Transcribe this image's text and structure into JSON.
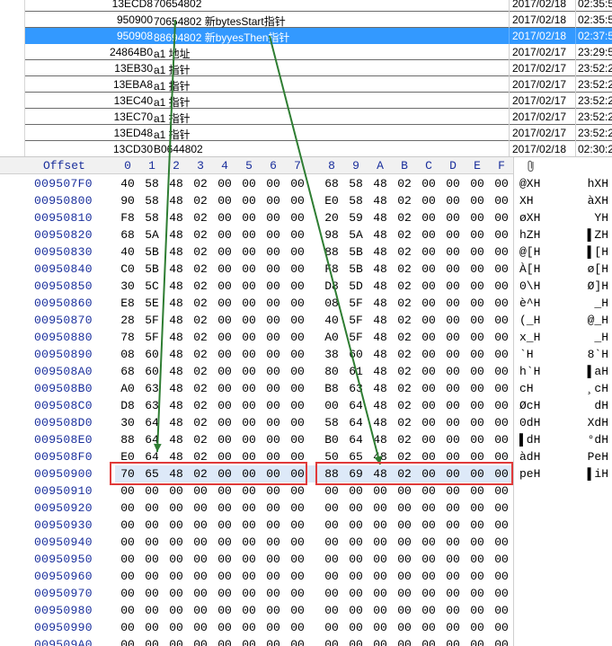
{
  "list": {
    "rows": [
      {
        "addr": "13ECD8",
        "desc": "70654802",
        "date": "2017/02/18",
        "time": "02:35:5",
        "selected": false
      },
      {
        "addr": "950900",
        "desc": "70654802  新bytesStart指针",
        "date": "2017/02/18",
        "time": "02:35:5",
        "selected": false
      },
      {
        "addr": "950908",
        "desc": "88694802  新byyesThen指针",
        "date": "2017/02/18",
        "time": "02:37:5",
        "selected": true
      },
      {
        "addr": "24864B0",
        "desc": "a1 地址",
        "date": "2017/02/17",
        "time": "23:29:5",
        "selected": false
      },
      {
        "addr": "13EB30",
        "desc": "a1 指针",
        "date": "2017/02/17",
        "time": "23:52:2",
        "selected": false
      },
      {
        "addr": "13EBA8",
        "desc": "a1 指针",
        "date": "2017/02/17",
        "time": "23:52:2",
        "selected": false
      },
      {
        "addr": "13EC40",
        "desc": "a1 指针",
        "date": "2017/02/17",
        "time": "23:52:2",
        "selected": false
      },
      {
        "addr": "13EC70",
        "desc": "a1 指针",
        "date": "2017/02/17",
        "time": "23:52:2",
        "selected": false
      },
      {
        "addr": "13ED48",
        "desc": "a1 指针",
        "date": "2017/02/17",
        "time": "23:52:2",
        "selected": false
      },
      {
        "addr": "13CD30",
        "desc": "B0644802",
        "date": "2017/02/18",
        "time": "02:30:2",
        "selected": false
      }
    ]
  },
  "hex": {
    "header_offset": "Offset",
    "column_headers": [
      "0",
      "1",
      "2",
      "3",
      "4",
      "5",
      "6",
      "7",
      "8",
      "9",
      "A",
      "B",
      "C",
      "D",
      "E",
      "F"
    ],
    "clip_icon": "paperclip-icon",
    "rows": [
      {
        "off": "009507F0",
        "bytes": [
          "40",
          "58",
          "48",
          "02",
          "00",
          "00",
          "00",
          "00",
          "68",
          "58",
          "48",
          "02",
          "00",
          "00",
          "00",
          "00"
        ],
        "t1": "@XH",
        "t2": "hXH"
      },
      {
        "off": "00950800",
        "bytes": [
          "90",
          "58",
          "48",
          "02",
          "00",
          "00",
          "00",
          "00",
          "E0",
          "58",
          "48",
          "02",
          "00",
          "00",
          "00",
          "00"
        ],
        "t1": " XH",
        "t2": "àXH"
      },
      {
        "off": "00950810",
        "bytes": [
          "F8",
          "58",
          "48",
          "02",
          "00",
          "00",
          "00",
          "00",
          "20",
          "59",
          "48",
          "02",
          "00",
          "00",
          "00",
          "00"
        ],
        "t1": "øXH",
        "t2": "YH"
      },
      {
        "off": "00950820",
        "bytes": [
          "68",
          "5A",
          "48",
          "02",
          "00",
          "00",
          "00",
          "00",
          "98",
          "5A",
          "48",
          "02",
          "00",
          "00",
          "00",
          "00"
        ],
        "t1": "hZH",
        "t2": "▌ZH"
      },
      {
        "off": "00950830",
        "bytes": [
          "40",
          "5B",
          "48",
          "02",
          "00",
          "00",
          "00",
          "00",
          "88",
          "5B",
          "48",
          "02",
          "00",
          "00",
          "00",
          "00"
        ],
        "t1": "@[H",
        "t2": "▌[H"
      },
      {
        "off": "00950840",
        "bytes": [
          "C0",
          "5B",
          "48",
          "02",
          "00",
          "00",
          "00",
          "00",
          "F8",
          "5B",
          "48",
          "02",
          "00",
          "00",
          "00",
          "00"
        ],
        "t1": "À[H",
        "t2": "ø[H"
      },
      {
        "off": "00950850",
        "bytes": [
          "30",
          "5C",
          "48",
          "02",
          "00",
          "00",
          "00",
          "00",
          "D8",
          "5D",
          "48",
          "02",
          "00",
          "00",
          "00",
          "00"
        ],
        "t1": "0\\H",
        "t2": "Ø]H"
      },
      {
        "off": "00950860",
        "bytes": [
          "E8",
          "5E",
          "48",
          "02",
          "00",
          "00",
          "00",
          "00",
          "08",
          "5F",
          "48",
          "02",
          "00",
          "00",
          "00",
          "00"
        ],
        "t1": "è^H",
        "t2": "_H"
      },
      {
        "off": "00950870",
        "bytes": [
          "28",
          "5F",
          "48",
          "02",
          "00",
          "00",
          "00",
          "00",
          "40",
          "5F",
          "48",
          "02",
          "00",
          "00",
          "00",
          "00"
        ],
        "t1": "(_H",
        "t2": "@_H"
      },
      {
        "off": "00950880",
        "bytes": [
          "78",
          "5F",
          "48",
          "02",
          "00",
          "00",
          "00",
          "00",
          "A0",
          "5F",
          "48",
          "02",
          "00",
          "00",
          "00",
          "00"
        ],
        "t1": "x_H",
        "t2": "_H"
      },
      {
        "off": "00950890",
        "bytes": [
          "08",
          "60",
          "48",
          "02",
          "00",
          "00",
          "00",
          "00",
          "38",
          "60",
          "48",
          "02",
          "00",
          "00",
          "00",
          "00"
        ],
        "t1": "`H",
        "t2": "8`H"
      },
      {
        "off": "009508A0",
        "bytes": [
          "68",
          "60",
          "48",
          "02",
          "00",
          "00",
          "00",
          "00",
          "80",
          "61",
          "48",
          "02",
          "00",
          "00",
          "00",
          "00"
        ],
        "t1": "h`H",
        "t2": "▌aH"
      },
      {
        "off": "009508B0",
        "bytes": [
          "A0",
          "63",
          "48",
          "02",
          "00",
          "00",
          "00",
          "00",
          "B8",
          "63",
          "48",
          "02",
          "00",
          "00",
          "00",
          "00"
        ],
        "t1": "cH",
        "t2": "¸cH"
      },
      {
        "off": "009508C0",
        "bytes": [
          "D8",
          "63",
          "48",
          "02",
          "00",
          "00",
          "00",
          "00",
          "00",
          "64",
          "48",
          "02",
          "00",
          "00",
          "00",
          "00"
        ],
        "t1": "ØcH",
        "t2": "dH"
      },
      {
        "off": "009508D0",
        "bytes": [
          "30",
          "64",
          "48",
          "02",
          "00",
          "00",
          "00",
          "00",
          "58",
          "64",
          "48",
          "02",
          "00",
          "00",
          "00",
          "00"
        ],
        "t1": "0dH",
        "t2": "XdH"
      },
      {
        "off": "009508E0",
        "bytes": [
          "88",
          "64",
          "48",
          "02",
          "00",
          "00",
          "00",
          "00",
          "B0",
          "64",
          "48",
          "02",
          "00",
          "00",
          "00",
          "00"
        ],
        "t1": "▌dH",
        "t2": "°dH"
      },
      {
        "off": "009508F0",
        "bytes": [
          "E0",
          "64",
          "48",
          "02",
          "00",
          "00",
          "00",
          "00",
          "50",
          "65",
          "48",
          "02",
          "00",
          "00",
          "00",
          "00"
        ],
        "t1": "àdH",
        "t2": "PeH"
      },
      {
        "off": "00950900",
        "bytes": [
          "70",
          "65",
          "48",
          "02",
          "00",
          "00",
          "00",
          "00",
          "88",
          "69",
          "48",
          "02",
          "00",
          "00",
          "00",
          "00"
        ],
        "t1": "peH",
        "t2": "▌iH"
      },
      {
        "off": "00950910",
        "bytes": [
          "00",
          "00",
          "00",
          "00",
          "00",
          "00",
          "00",
          "00",
          "00",
          "00",
          "00",
          "00",
          "00",
          "00",
          "00",
          "00"
        ],
        "t1": "",
        "t2": ""
      },
      {
        "off": "00950920",
        "bytes": [
          "00",
          "00",
          "00",
          "00",
          "00",
          "00",
          "00",
          "00",
          "00",
          "00",
          "00",
          "00",
          "00",
          "00",
          "00",
          "00"
        ],
        "t1": "",
        "t2": ""
      },
      {
        "off": "00950930",
        "bytes": [
          "00",
          "00",
          "00",
          "00",
          "00",
          "00",
          "00",
          "00",
          "00",
          "00",
          "00",
          "00",
          "00",
          "00",
          "00",
          "00"
        ],
        "t1": "",
        "t2": ""
      },
      {
        "off": "00950940",
        "bytes": [
          "00",
          "00",
          "00",
          "00",
          "00",
          "00",
          "00",
          "00",
          "00",
          "00",
          "00",
          "00",
          "00",
          "00",
          "00",
          "00"
        ],
        "t1": "",
        "t2": ""
      },
      {
        "off": "00950950",
        "bytes": [
          "00",
          "00",
          "00",
          "00",
          "00",
          "00",
          "00",
          "00",
          "00",
          "00",
          "00",
          "00",
          "00",
          "00",
          "00",
          "00"
        ],
        "t1": "",
        "t2": ""
      },
      {
        "off": "00950960",
        "bytes": [
          "00",
          "00",
          "00",
          "00",
          "00",
          "00",
          "00",
          "00",
          "00",
          "00",
          "00",
          "00",
          "00",
          "00",
          "00",
          "00"
        ],
        "t1": "",
        "t2": ""
      },
      {
        "off": "00950970",
        "bytes": [
          "00",
          "00",
          "00",
          "00",
          "00",
          "00",
          "00",
          "00",
          "00",
          "00",
          "00",
          "00",
          "00",
          "00",
          "00",
          "00"
        ],
        "t1": "",
        "t2": ""
      },
      {
        "off": "00950980",
        "bytes": [
          "00",
          "00",
          "00",
          "00",
          "00",
          "00",
          "00",
          "00",
          "00",
          "00",
          "00",
          "00",
          "00",
          "00",
          "00",
          "00"
        ],
        "t1": "",
        "t2": ""
      },
      {
        "off": "00950990",
        "bytes": [
          "00",
          "00",
          "00",
          "00",
          "00",
          "00",
          "00",
          "00",
          "00",
          "00",
          "00",
          "00",
          "00",
          "00",
          "00",
          "00"
        ],
        "t1": "",
        "t2": ""
      },
      {
        "off": "009509A0",
        "bytes": [
          "00",
          "00",
          "00",
          "00",
          "00",
          "00",
          "00",
          "00",
          "00",
          "00",
          "00",
          "00",
          "00",
          "00",
          "00",
          "00"
        ],
        "t1": "",
        "t2": ""
      }
    ]
  },
  "colors": {
    "selection": "#3399ff",
    "offset_text": "#1a2f9c",
    "annotation_box": "#e03a3a",
    "annotation_arrow": "#2e7d32"
  }
}
